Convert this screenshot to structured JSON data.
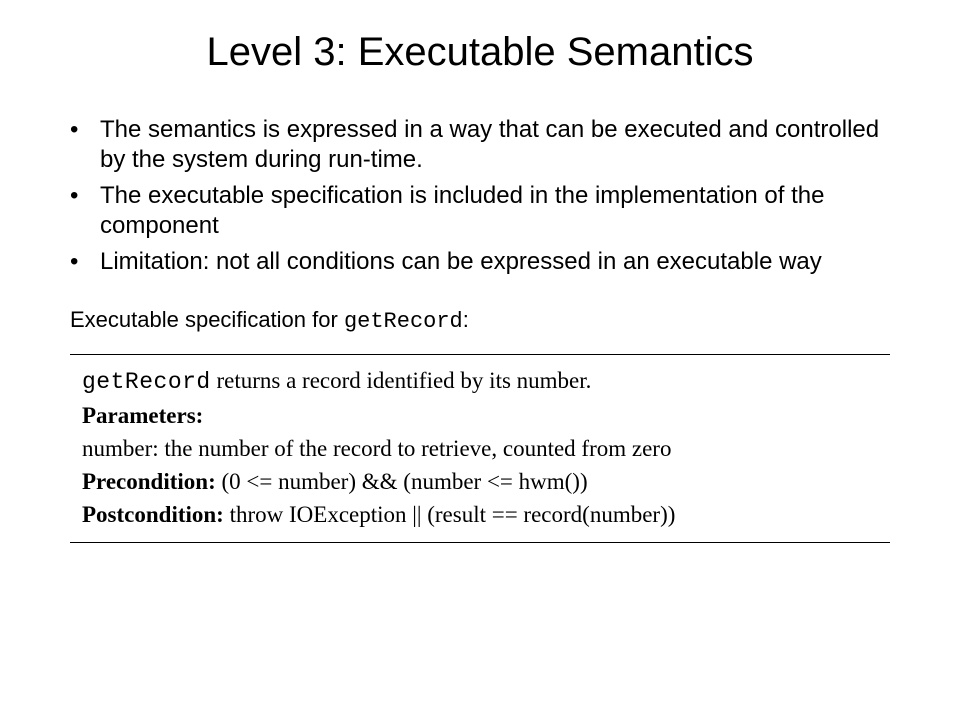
{
  "title": "Level 3: Executable Semantics",
  "bullets": [
    "The semantics is expressed in a way that can be executed and controlled by the system during run-time.",
    "The executable specification is included in the implementation of the component",
    "Limitation: not all conditions can be expressed in an executable way"
  ],
  "intro_prefix": "Executable specification for ",
  "intro_code": "getRecord",
  "intro_suffix": ":",
  "spec": {
    "fn": "getRecord",
    "fn_desc": " returns a record identified by its number.",
    "params_label": "Parameters:",
    "param_line": "number: the number of the record to retrieve, counted from zero",
    "pre_label": "Precondition:",
    "pre_expr": " (0 <= number) && (number <= hwm())",
    "post_label": "Postcondition:",
    "post_expr": " throw IOException || (result == record(number))"
  }
}
